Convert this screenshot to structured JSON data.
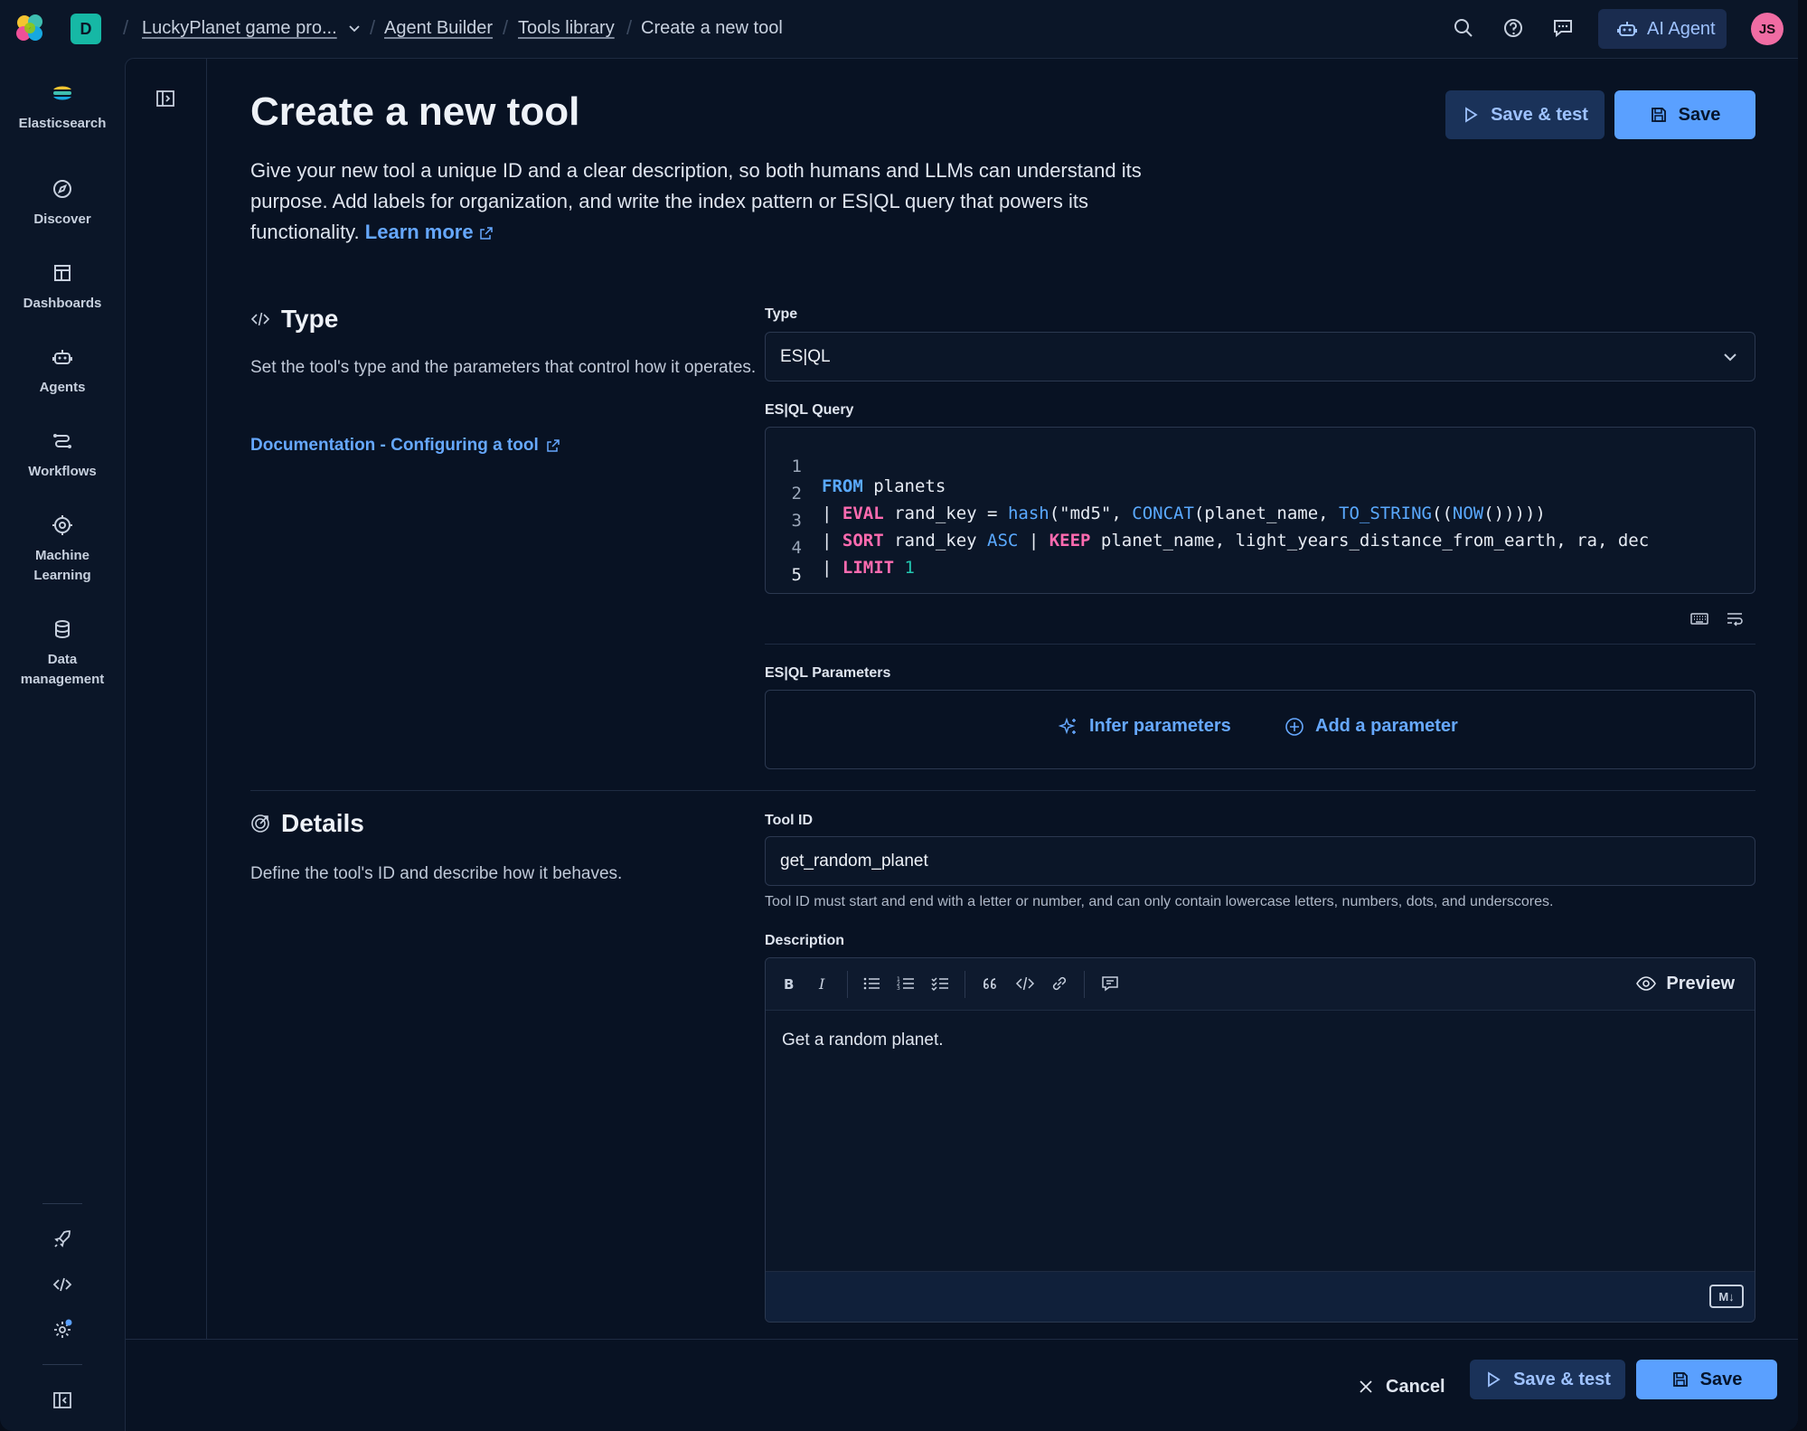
{
  "header": {
    "space_initial": "D",
    "breadcrumbs": [
      "LuckyPlanet game pro...",
      "Agent Builder",
      "Tools library",
      "Create a new tool"
    ],
    "ai_agent_label": "AI Agent",
    "avatar_initials": "JS"
  },
  "sidebar": {
    "items": [
      {
        "label": "Elasticsearch",
        "icon": "elasticsearch-logo-icon"
      },
      {
        "label": "Discover",
        "icon": "compass-icon"
      },
      {
        "label": "Dashboards",
        "icon": "dashboard-icon"
      },
      {
        "label": "Agents",
        "icon": "robot-icon"
      },
      {
        "label": "Workflows",
        "icon": "workflow-icon"
      },
      {
        "label": "Machine Learning",
        "icon": "machine-learning-icon"
      },
      {
        "label": "Data management",
        "icon": "database-icon"
      }
    ],
    "bottom_icons": [
      "rocket-icon",
      "code-icon",
      "gear-icon",
      "collapse-nav-icon"
    ]
  },
  "page": {
    "title": "Create a new tool",
    "intro_text": "Give your new tool a unique ID and a clear description, so both humans and LLMs can understand its purpose. Add labels for organization, and write the index pattern or ES|QL query that powers its functionality.",
    "learn_more": "Learn more",
    "save_test_label": "Save & test",
    "save_label": "Save"
  },
  "type_section": {
    "title": "Type",
    "description": "Set the tool's type and the parameters that control how it operates.",
    "doc_link": "Documentation - Configuring a tool",
    "type_label": "Type",
    "type_value": "ES|QL",
    "query_label": "ES|QL Query",
    "query_line_numbers": [
      "1",
      "2",
      "3",
      "4",
      "5"
    ],
    "params_label": "ES|QL Parameters",
    "infer_params": "Infer parameters",
    "add_param": "Add a parameter"
  },
  "details_section": {
    "title": "Details",
    "description": "Define the tool's ID and describe how it behaves.",
    "tool_id_label": "Tool ID",
    "tool_id_value": "get_random_planet",
    "tool_id_help": "Tool ID must start and end with a letter or number, and can only contain lowercase letters, numbers, dots, and underscores.",
    "description_label": "Description",
    "description_value": "Get a random planet.",
    "preview_label": "Preview",
    "md_badge": "M↓"
  },
  "footer": {
    "cancel": "Cancel",
    "save_test": "Save & test",
    "save": "Save"
  },
  "colors": {
    "accent": "#5aa0ff",
    "link": "#66a8ff",
    "keyword": "#ff6bb0",
    "function": "#5aa9ff",
    "number": "#22c7b0",
    "space_badge": "#16b8a5",
    "avatar": "#f06ca3"
  }
}
